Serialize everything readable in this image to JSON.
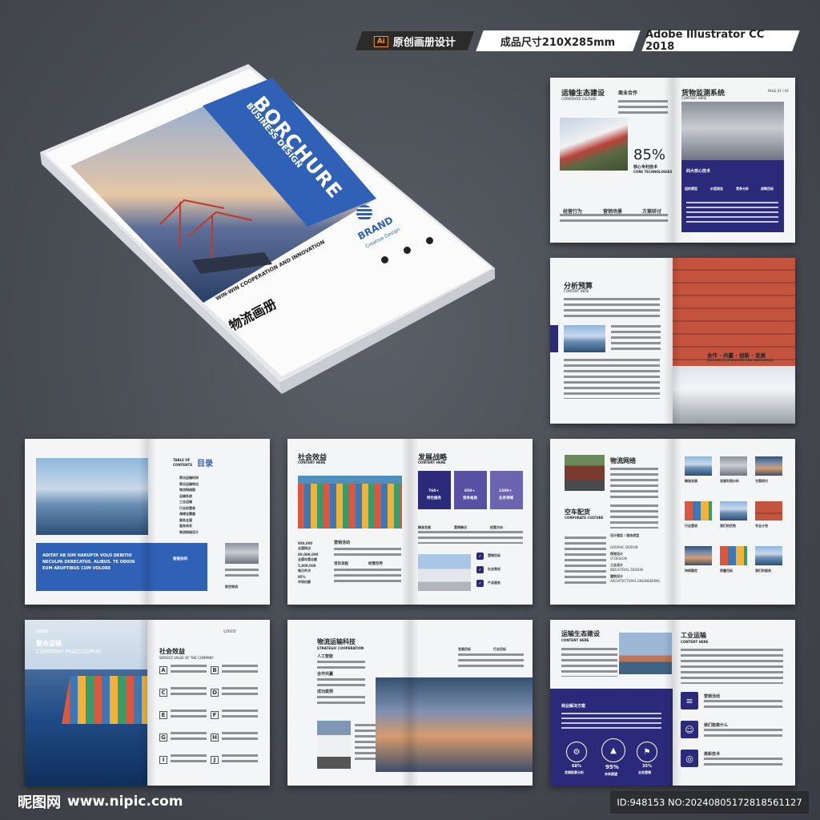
{
  "header": {
    "tag_original_icon": "Ai",
    "tag_original": "原创画册设计",
    "tag_size": "成品尺寸210X285mm",
    "tag_software": "Adobe Illustrator CC 2018"
  },
  "cover": {
    "title_en": "BORCHURE",
    "subtitle_en": "BUSINESS DESIGN",
    "brand": "BRAND",
    "brand_sub": "Creative Design",
    "title_cn": "物流画册",
    "tagline": "WIN-WIN COOPERATION AND INNOVATION",
    "contact_icons": [
      "phone-icon",
      "email-icon",
      "web-icon"
    ]
  },
  "spread1": {
    "title": "运输生态建设",
    "title_en": "CORPORATE CULTURE",
    "label_cooperation": "商业合作",
    "percent": "85%",
    "percent_label": "核心专利技术",
    "percent_label_en": "CORE TECHNOLOGIES",
    "items": [
      "经营行为",
      "营销场景",
      "方案研讨"
    ],
    "right_title": "货物监测系统",
    "right_title_en": "CONTENT HERE",
    "page_no": "PAGE 01 / 02",
    "four_title": "四大核心技术",
    "four_items": [
      "组织模型",
      "价值观念",
      "竞争分析",
      "战略目标"
    ]
  },
  "spread2": {
    "title": "分析预算",
    "title_en": "CONTENT HERE",
    "caption": "合作 · 共赢 · 创新 · 发展",
    "caption_en": "WIN-WIN COOPERATION AND INNOVATION"
  },
  "spread3": {
    "toc_en": "TABLE OF CONTENTS",
    "toc_cn": "目录",
    "toc_items": [
      "简况运输时间",
      "简况运输特点",
      "物流网络图",
      "运输系统",
      "工业运输",
      "行业的营收",
      "海域全覆盖",
      "服务全国",
      "服务体系",
      "物流网络设计"
    ],
    "banner_text": "ADITAT AB IUM HARUPTA VOLO DEBITIO NECULPA DERECATUS. ALIBUS. TE ODION EUM ARUPTIBUS CUM VOLORE",
    "banner_label": "智能协同",
    "caption": "航空物流"
  },
  "spread4": {
    "title": "社会效益",
    "title_en": "CONTENT HERE",
    "stats": [
      {
        "value": "800,000",
        "label": "全国网点"
      },
      {
        "value": "80,000,000",
        "label": "全国年营业额"
      },
      {
        "value": "5,800,000",
        "label": "每日件次"
      },
      {
        "value": "95%",
        "label": "市场份额"
      }
    ],
    "sub1": "营销活动",
    "sub2": "项目流程",
    "sub3": "经营形势",
    "right_title": "发展战略",
    "right_title_en": "CONTENT HERE",
    "cards": [
      {
        "value": "760+",
        "label": "特色服务"
      },
      {
        "value": "650+",
        "label": "竞争格局"
      },
      {
        "value": "1200+",
        "label": "业务领域"
      }
    ],
    "cols": [
      "精准发展",
      "营销情况",
      "经营方向"
    ],
    "bullets": [
      "营销目标",
      "社会责任",
      "产品服务"
    ]
  },
  "spread5": {
    "title": "物流网络",
    "sub_title": "空车配货",
    "sub_title_en": "CORPORATE CULTURE",
    "list": [
      {
        "cn": "设计理念 / 服务类型",
        "en": "GRAPHIC DESIGN"
      },
      {
        "cn": "视觉设计",
        "en": "VI DESIGN"
      },
      {
        "cn": "工业设计",
        "en": "INDUSTRIAL DESIGN"
      },
      {
        "cn": "建筑设计",
        "en": "ARCHITECTURAL ENGINEERING"
      }
    ],
    "grid_labels": [
      "精准发展",
      "发展利润分析",
      "方案研讨",
      "行业营收",
      "我们的优势",
      "专业计划",
      "持续稳定",
      "质量目标",
      "我们的服务"
    ]
  },
  "spread6": {
    "logo": "LOGO",
    "title": "整合运输",
    "title_en": "COMPANY PHILOSOPHY",
    "right_title": "社会效益",
    "right_title_en": "SERVICE VALUE OF THE COMPANY",
    "right_logo": "LOGO",
    "letters": [
      "A",
      "B",
      "C",
      "D",
      "E",
      "F",
      "G",
      "H",
      "I",
      "J"
    ]
  },
  "spread7": {
    "title": "物流运输科技",
    "title_en": "STRATEGIC COOPERATION",
    "items": [
      "人工智能",
      "合作共赢",
      "成功案例"
    ],
    "tags": [
      "发展目标",
      "行业目标"
    ]
  },
  "spread8": {
    "title": "运输生态建设",
    "title_en": "CONTENT HERE",
    "band_label": "商业解决方案",
    "stats": [
      {
        "value": "68%",
        "label": "发展前景分析"
      },
      {
        "value": "95%",
        "label": "未来展望"
      },
      {
        "value": "35%",
        "label": "业务营销"
      }
    ],
    "right_title": "工业运输",
    "right_title_en": "CONTENT HERE",
    "right_items": [
      "营销活动",
      "我们能做什么",
      "高新技术"
    ]
  },
  "footer": {
    "watermark_logo": "昵图网",
    "watermark_url": "www.nipic.com",
    "image_id": "ID:948153 NO:20240805172818561127"
  }
}
